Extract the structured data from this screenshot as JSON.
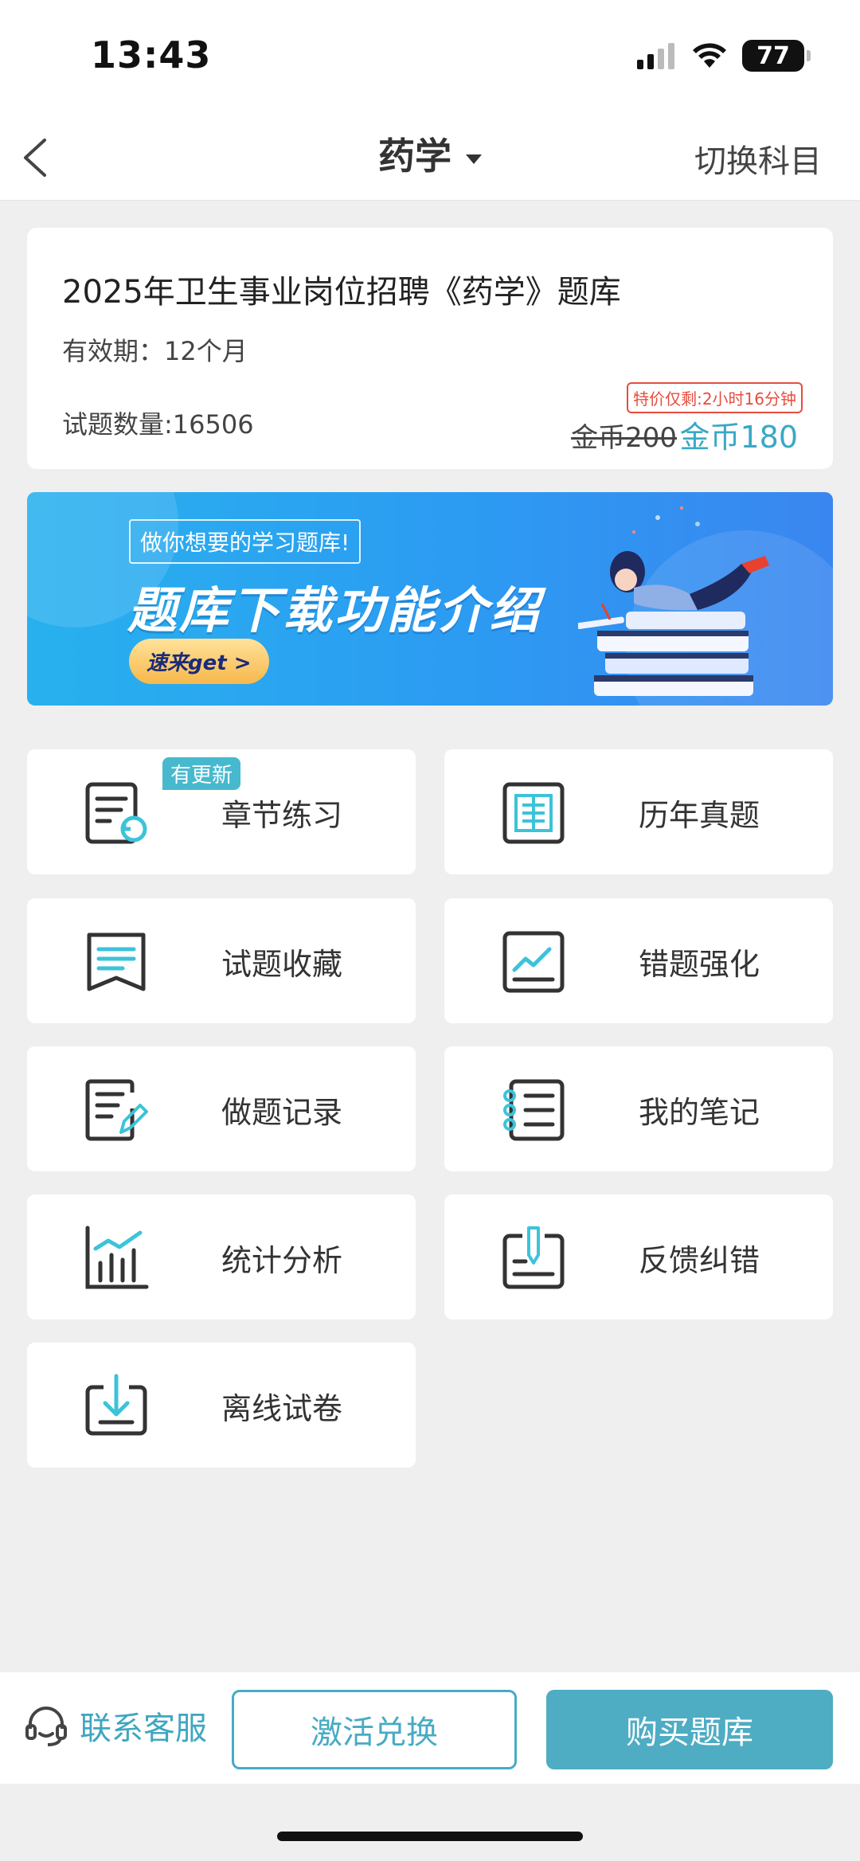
{
  "status": {
    "time": "13:43",
    "battery": "77"
  },
  "nav": {
    "title": "药学",
    "switch_label": "切换科目"
  },
  "card": {
    "title": "2025年卫生事业岗位招聘《药学》题库",
    "validity": "有效期：12个月",
    "count": "试题数量:16506",
    "promo": "特价仅剩:2小时16分钟",
    "old_price": "金币200",
    "new_price": "金币180"
  },
  "banner": {
    "subtitle": "做你想要的学习题库!",
    "title": "题库下载功能介绍",
    "button": "速来get >"
  },
  "menu": [
    {
      "label": "章节练习",
      "icon": "chapter-practice-icon",
      "badge": "有更新"
    },
    {
      "label": "历年真题",
      "icon": "past-exams-icon"
    },
    {
      "label": "试题收藏",
      "icon": "favorites-icon"
    },
    {
      "label": "错题强化",
      "icon": "wrong-questions-icon"
    },
    {
      "label": "做题记录",
      "icon": "practice-record-icon"
    },
    {
      "label": "我的笔记",
      "icon": "notes-icon"
    },
    {
      "label": "统计分析",
      "icon": "statistics-icon"
    },
    {
      "label": "反馈纠错",
      "icon": "feedback-icon"
    },
    {
      "label": "离线试卷",
      "icon": "offline-papers-icon"
    }
  ],
  "bottom": {
    "service": "联系客服",
    "activate": "激活兑换",
    "buy": "购买题库"
  },
  "colors": {
    "accent": "#4eacc3",
    "icon_accent": "#3cc3d9",
    "promo": "#e84c3d"
  }
}
